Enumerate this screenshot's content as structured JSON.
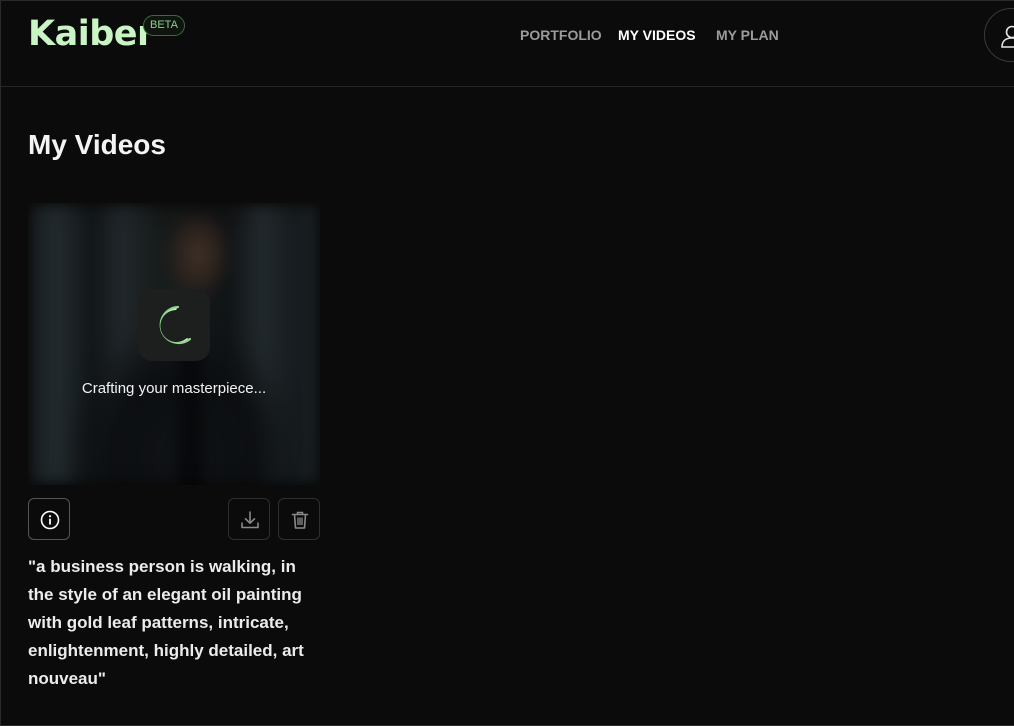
{
  "brand": {
    "logo_text": "Kaiber",
    "badge": "BETA",
    "accent_color": "#c9f5c4"
  },
  "nav": {
    "items": [
      {
        "label": "PORTFOLIO",
        "active": false
      },
      {
        "label": "MY VIDEOS",
        "active": true
      },
      {
        "label": "MY PLAN",
        "active": false
      }
    ],
    "profile_icon": "user-icon"
  },
  "page": {
    "title": "My Videos"
  },
  "videos": [
    {
      "status_text": "Crafting your masterpiece...",
      "status_icon": "loading-spinner-icon",
      "actions": {
        "info_icon": "info-icon",
        "download_icon": "download-icon",
        "delete_icon": "trash-icon"
      },
      "prompt": "\"a business person is walking, in the style of an elegant oil painting with gold leaf patterns, intricate, enlightenment, highly detailed, art nouveau\""
    }
  ]
}
